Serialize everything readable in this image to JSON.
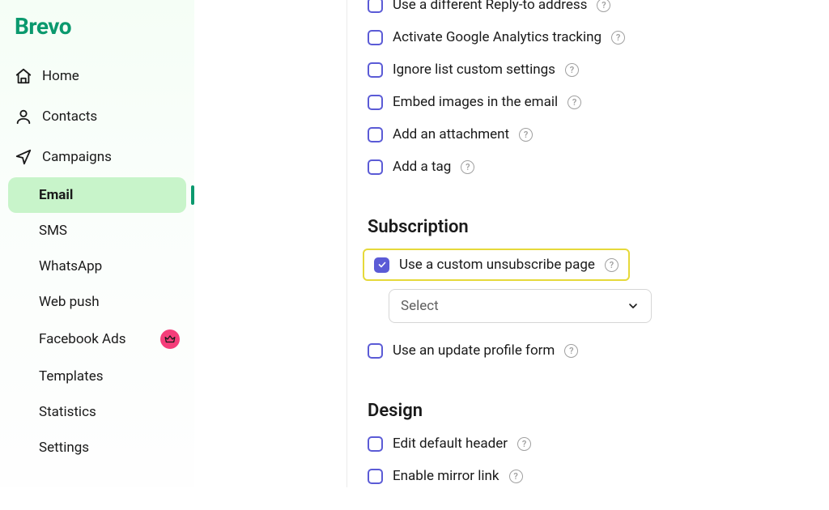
{
  "brand": "Brevo",
  "sidebar": {
    "top": [
      {
        "label": "Home"
      },
      {
        "label": "Contacts"
      },
      {
        "label": "Campaigns"
      }
    ],
    "sub": [
      {
        "label": "Email",
        "active": true
      },
      {
        "label": "SMS"
      },
      {
        "label": "WhatsApp"
      },
      {
        "label": "Web push"
      },
      {
        "label": "Facebook Ads",
        "badge": true
      },
      {
        "label": "Templates"
      },
      {
        "label": "Statistics"
      },
      {
        "label": "Settings"
      }
    ]
  },
  "options": {
    "top_cutoff": {
      "label": "Use a different Reply-to address",
      "checked": false
    },
    "general": [
      {
        "label": "Activate Google Analytics tracking",
        "checked": false
      },
      {
        "label": "Ignore list custom settings",
        "checked": false
      },
      {
        "label": "Embed images in the email",
        "checked": false
      },
      {
        "label": "Add an attachment",
        "checked": false
      },
      {
        "label": "Add a tag",
        "checked": false
      }
    ],
    "subscription_title": "Subscription",
    "subscription": [
      {
        "label": "Use a custom unsubscribe page",
        "checked": true,
        "highlighted": true
      },
      {
        "label": "Use an update profile form",
        "checked": false
      }
    ],
    "select_placeholder": "Select",
    "design_title": "Design",
    "design": [
      {
        "label": "Edit default header",
        "checked": false
      },
      {
        "label": "Enable mirror link",
        "checked": false
      }
    ]
  }
}
